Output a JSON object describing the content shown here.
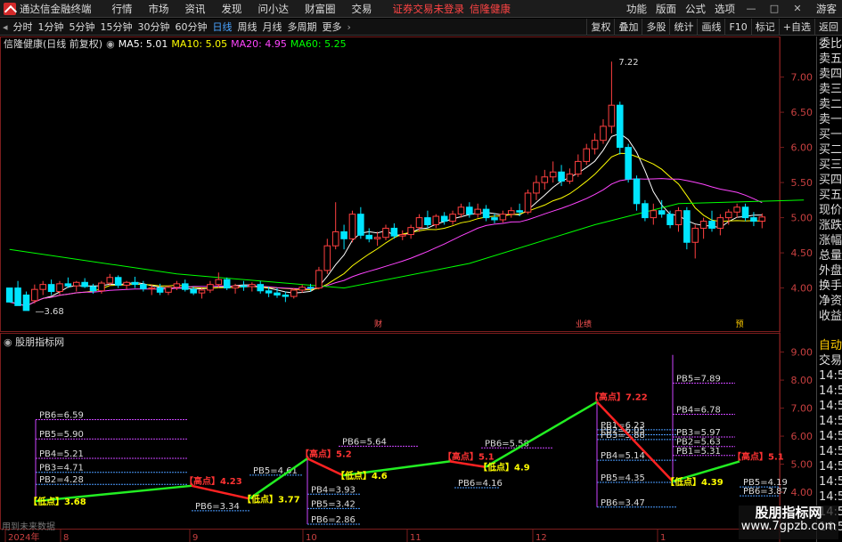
{
  "app": {
    "title": "通达信金融终端",
    "menu": [
      "行情",
      "市场",
      "资讯",
      "发现",
      "问小达",
      "财富圈",
      "交易"
    ],
    "login_status": "证券交易未登录",
    "account": "信隆健康",
    "right_menu": [
      "功能",
      "版面",
      "公式",
      "选项"
    ],
    "guest": "游客",
    "window_controls": [
      "minimize-icon",
      "maximize-icon",
      "close-icon"
    ]
  },
  "periods": {
    "items": [
      "分时",
      "1分钟",
      "5分钟",
      "15分钟",
      "30分钟",
      "60分钟",
      "日线",
      "周线",
      "月线",
      "多周期",
      "更多"
    ],
    "active": "日线"
  },
  "toolbar": [
    "复权",
    "叠加",
    "多股",
    "统计",
    "画线",
    "F10",
    "标记",
    "+自选",
    "返回"
  ],
  "stock": {
    "title": "信隆健康(日线 前复权)",
    "ma": [
      {
        "label": "MA5: 5.01",
        "color": "#ffffff"
      },
      {
        "label": "MA10: 5.05",
        "color": "#ffff00"
      },
      {
        "label": "MA20: 4.95",
        "color": "#ff44ff"
      },
      {
        "label": "MA60: 5.25",
        "color": "#00ff00"
      }
    ]
  },
  "right_panel": {
    "upper": [
      "委比",
      "卖五",
      "卖四",
      "卖三",
      "卖二",
      "卖一",
      "买一",
      "买二",
      "买三",
      "买四",
      "买五",
      "现价",
      "涨跌",
      "涨幅",
      "总量",
      "外盘",
      "换手",
      "净资",
      "收益"
    ],
    "lower": [
      "自动",
      "交易",
      "14:5",
      "14:5",
      "14:5",
      "14:5",
      "14:5",
      "14:5",
      "14:5",
      "14:5",
      "14:5",
      "14:5",
      "14:5"
    ]
  },
  "price_axis": [
    "7.00",
    "6.50",
    "6.00",
    "5.50",
    "5.00",
    "4.50",
    "4.00"
  ],
  "indicator": {
    "title": "股朋指标网",
    "axis": [
      "9.00",
      "8.00",
      "7.00",
      "6.00",
      "5.00",
      "4.00"
    ],
    "future_note": "用到未来数据"
  },
  "markers": [
    "财",
    "业绩",
    "预"
  ],
  "time_axis": [
    "2024年",
    "8",
    "9",
    "10",
    "11",
    "12",
    "1"
  ],
  "watermark": {
    "line1": "股朋指标网",
    "line2": "www.7gpzb.com"
  },
  "chart_data": {
    "type": "candlestick",
    "price_range": [
      3.4,
      7.4
    ],
    "annotations": {
      "high": 7.22,
      "low": 3.68
    },
    "candles": [
      [
        4.0,
        4.0,
        3.9,
        3.8
      ],
      [
        4.0,
        4.1,
        3.8,
        3.75
      ],
      [
        3.9,
        3.95,
        3.75,
        3.68
      ],
      [
        3.82,
        4.05,
        3.78,
        3.98
      ],
      [
        3.98,
        4.1,
        3.9,
        4.05
      ],
      [
        4.05,
        4.12,
        3.9,
        3.95
      ],
      [
        3.95,
        4.1,
        3.9,
        4.06
      ],
      [
        4.06,
        4.15,
        4.0,
        4.03
      ],
      [
        4.03,
        4.1,
        3.95,
        4.08
      ],
      [
        4.08,
        4.14,
        4.0,
        4.02
      ],
      [
        4.02,
        4.06,
        3.92,
        3.96
      ],
      [
        3.96,
        4.1,
        3.92,
        4.07
      ],
      [
        4.07,
        4.2,
        4.03,
        4.15
      ],
      [
        4.15,
        4.18,
        4.0,
        4.04
      ],
      [
        4.04,
        4.1,
        3.98,
        4.08
      ],
      [
        4.08,
        4.16,
        4.0,
        4.05
      ],
      [
        4.05,
        4.1,
        3.95,
        3.99
      ],
      [
        3.99,
        4.05,
        3.9,
        4.0
      ],
      [
        4.0,
        4.06,
        3.9,
        3.94
      ],
      [
        3.94,
        4.04,
        3.9,
        4.01
      ],
      [
        4.01,
        4.1,
        3.97,
        4.06
      ],
      [
        4.06,
        4.12,
        3.95,
        3.98
      ],
      [
        3.98,
        4.02,
        3.9,
        3.93
      ],
      [
        3.93,
        4.0,
        3.85,
        3.97
      ],
      [
        3.97,
        4.1,
        3.93,
        4.05
      ],
      [
        4.05,
        4.22,
        4.0,
        4.12
      ],
      [
        4.12,
        4.15,
        3.97,
        4.0
      ],
      [
        4.0,
        4.06,
        3.92,
        4.03
      ],
      [
        4.03,
        4.1,
        3.96,
        4.02
      ],
      [
        4.02,
        4.08,
        3.95,
        4.05
      ],
      [
        4.05,
        4.1,
        3.92,
        3.96
      ],
      [
        3.96,
        4.02,
        3.87,
        3.93
      ],
      [
        3.93,
        4.0,
        3.86,
        3.9
      ],
      [
        3.9,
        3.95,
        3.8,
        3.88
      ],
      [
        3.88,
        4.0,
        3.85,
        3.97
      ],
      [
        3.97,
        4.05,
        3.93,
        4.01
      ],
      [
        4.01,
        4.06,
        3.95,
        4.0
      ],
      [
        4.0,
        4.3,
        3.98,
        4.25
      ],
      [
        4.25,
        4.7,
        4.2,
        4.6
      ],
      [
        4.6,
        5.22,
        4.55,
        4.8
      ],
      [
        4.8,
        4.9,
        4.55,
        4.7
      ],
      [
        4.7,
        5.1,
        4.65,
        5.05
      ],
      [
        5.05,
        5.15,
        4.7,
        4.75
      ],
      [
        4.75,
        4.85,
        4.65,
        4.7
      ],
      [
        4.7,
        4.8,
        4.6,
        4.72
      ],
      [
        4.72,
        4.9,
        4.68,
        4.85
      ],
      [
        4.85,
        4.92,
        4.7,
        4.74
      ],
      [
        4.74,
        4.82,
        4.68,
        4.76
      ],
      [
        4.76,
        4.9,
        4.7,
        4.86
      ],
      [
        4.86,
        5.05,
        4.8,
        5.0
      ],
      [
        5.0,
        5.1,
        4.85,
        4.9
      ],
      [
        4.9,
        5.05,
        4.85,
        5.02
      ],
      [
        5.02,
        5.08,
        4.9,
        4.95
      ],
      [
        4.95,
        5.1,
        4.9,
        5.05
      ],
      [
        5.05,
        5.2,
        5.0,
        5.15
      ],
      [
        5.15,
        5.22,
        5.0,
        5.05
      ],
      [
        5.05,
        5.2,
        5.0,
        5.12
      ],
      [
        5.12,
        5.18,
        4.95,
        5.0
      ],
      [
        5.0,
        5.06,
        4.92,
        4.97
      ],
      [
        4.97,
        5.1,
        4.93,
        5.05
      ],
      [
        5.05,
        5.15,
        5.0,
        5.1
      ],
      [
        5.1,
        5.2,
        5.02,
        5.08
      ],
      [
        5.08,
        5.4,
        5.05,
        5.35
      ],
      [
        5.35,
        5.6,
        5.25,
        5.5
      ],
      [
        5.5,
        5.68,
        5.4,
        5.58
      ],
      [
        5.58,
        5.8,
        5.5,
        5.65
      ],
      [
        5.65,
        5.75,
        5.45,
        5.52
      ],
      [
        5.52,
        5.7,
        5.48,
        5.62
      ],
      [
        5.62,
        5.9,
        5.58,
        5.8
      ],
      [
        5.8,
        6.05,
        5.75,
        5.98
      ],
      [
        5.98,
        6.2,
        5.9,
        6.1
      ],
      [
        6.1,
        6.4,
        6.05,
        6.3
      ],
      [
        6.3,
        7.22,
        6.2,
        6.6
      ],
      [
        6.6,
        6.65,
        5.9,
        6.0
      ],
      [
        6.0,
        6.05,
        5.5,
        5.55
      ],
      [
        5.55,
        5.6,
        5.1,
        5.2
      ],
      [
        5.2,
        5.25,
        4.95,
        5.0
      ],
      [
        5.0,
        5.2,
        4.9,
        5.1
      ],
      [
        5.1,
        5.25,
        5.0,
        5.05
      ],
      [
        5.05,
        5.1,
        4.85,
        4.9
      ],
      [
        4.9,
        5.15,
        4.8,
        5.1
      ],
      [
        5.1,
        5.15,
        4.55,
        4.65
      ],
      [
        4.65,
        4.9,
        4.42,
        4.85
      ],
      [
        4.85,
        5.0,
        4.7,
        4.95
      ],
      [
        4.95,
        5.1,
        4.8,
        4.85
      ],
      [
        4.85,
        5.05,
        4.75,
        5.0
      ],
      [
        5.0,
        5.12,
        4.9,
        5.08
      ],
      [
        5.08,
        5.2,
        5.0,
        5.15
      ],
      [
        5.15,
        5.2,
        4.95,
        5.0
      ],
      [
        5.0,
        5.08,
        4.88,
        4.95
      ],
      [
        4.95,
        5.06,
        4.85,
        5.01
      ]
    ],
    "ma60_points": [
      [
        0,
        4.55
      ],
      [
        20,
        4.2
      ],
      [
        40,
        4.0
      ],
      [
        55,
        4.35
      ],
      [
        70,
        4.9
      ],
      [
        80,
        5.2
      ],
      [
        95,
        5.25
      ]
    ],
    "indicator_labels": [
      {
        "text": "PB6=6.59",
        "v": 6.59
      },
      {
        "text": "PB5=5.90",
        "v": 5.9
      },
      {
        "text": "PB4=5.21",
        "v": 5.21
      },
      {
        "text": "PB3=4.71",
        "v": 4.71
      },
      {
        "text": "PB2=4.28",
        "v": 4.28
      },
      {
        "text": "PB6=5.64",
        "v": 5.64
      },
      {
        "text": "PB6=5.58",
        "v": 5.58
      },
      {
        "text": "PB1=6.23",
        "v": 6.23
      },
      {
        "text": "PB2=6.05",
        "v": 6.05
      },
      {
        "text": "PB3=5.88",
        "v": 5.88
      },
      {
        "text": "PB4=5.14",
        "v": 5.14
      },
      {
        "text": "PB5=4.35",
        "v": 4.35
      },
      {
        "text": "PB6=3.47",
        "v": 3.47
      },
      {
        "text": "PB5=7.89",
        "v": 7.89
      },
      {
        "text": "PB4=6.78",
        "v": 6.78
      },
      {
        "text": "PB3=5.97",
        "v": 5.97
      },
      {
        "text": "PB2=5.63",
        "v": 5.63
      },
      {
        "text": "PB1=5.31",
        "v": 5.31
      },
      {
        "text": "PB5=3.42",
        "v": 3.42
      },
      {
        "text": "PB6=2.86",
        "v": 2.86
      },
      {
        "text": "PB4=3.93",
        "v": 3.93
      },
      {
        "text": "PB6=4.16",
        "v": 4.16
      },
      {
        "text": "PB5=4.19",
        "v": 4.19
      },
      {
        "text": "PB6=3.87",
        "v": 3.87
      },
      {
        "text": "PB6=3.34",
        "v": 3.34
      },
      {
        "text": "PB5=4.61",
        "v": 4.61
      }
    ],
    "zigzag": [
      {
        "label": "低点",
        "v": 3.68
      },
      {
        "label": "高点",
        "v": 4.23
      },
      {
        "label": "低点",
        "v": 3.77
      },
      {
        "label": "高点",
        "v": 5.2
      },
      {
        "label": "低点",
        "v": 4.6
      },
      {
        "label": "高点",
        "v": 5.1
      },
      {
        "label": "低点",
        "v": 4.9
      },
      {
        "label": "高点",
        "v": 7.22
      },
      {
        "label": "低点",
        "v": 4.39
      },
      {
        "label": "高点",
        "v": 5.1
      }
    ]
  }
}
